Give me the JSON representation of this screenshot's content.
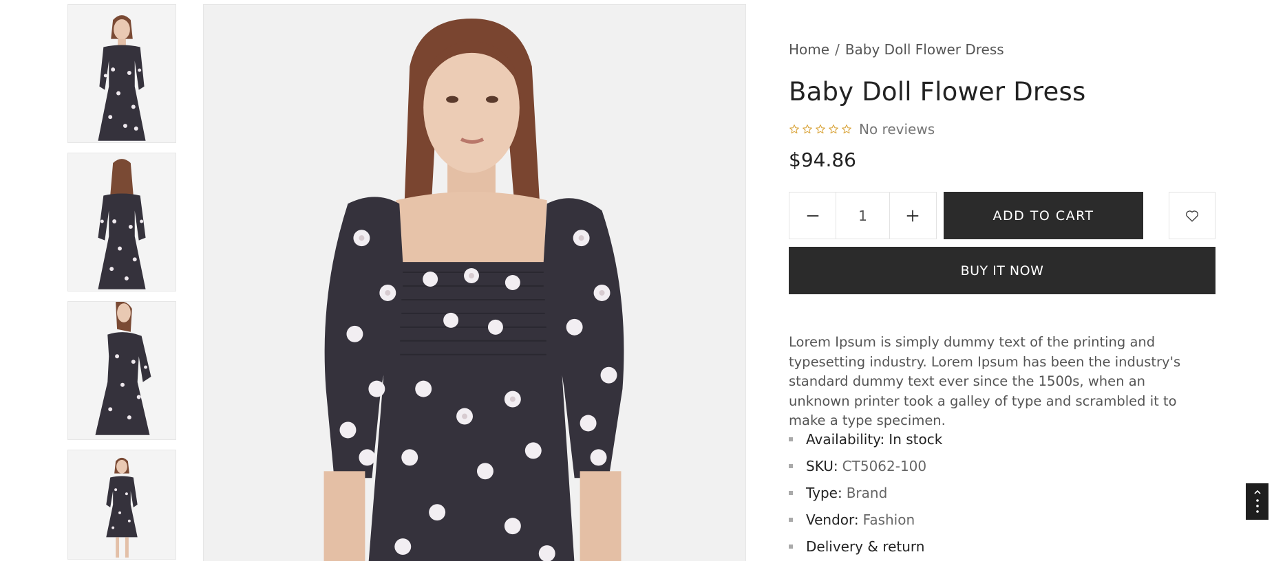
{
  "breadcrumb": {
    "home": "Home",
    "separator": "/",
    "current": "Baby Doll Flower Dress"
  },
  "product": {
    "title": "Baby Doll Flower Dress",
    "rating": 0,
    "reviews_text": "No reviews",
    "price": "$94.86",
    "quantity": "1",
    "add_to_cart": "ADD TO CART",
    "buy_now": "BUY IT NOW",
    "description": "Lorem Ipsum is simply dummy text of the printing and typesetting industry. Lorem Ipsum has been the industry's standard dummy text ever since the 1500s, when an unknown printer took a galley of type and scrambled it to make a type specimen.",
    "meta": {
      "availability_label": "Availability:",
      "availability_value": "In stock",
      "sku_label": "SKU:",
      "sku_value": "CT5062-100",
      "type_label": "Type:",
      "type_value": "Brand",
      "vendor_label": "Vendor:",
      "vendor_value": "Fashion",
      "delivery_label": "Delivery & return"
    }
  },
  "colors": {
    "dress": "#35323c",
    "button": "#2b2b2b",
    "star": "#d9a43a",
    "background": "#f1f1f1"
  },
  "icons": {
    "minus": "minus-icon",
    "plus": "plus-icon",
    "wishlist": "heart-icon",
    "star": "star-outline-icon",
    "scroll": "scroll-top-icon"
  }
}
